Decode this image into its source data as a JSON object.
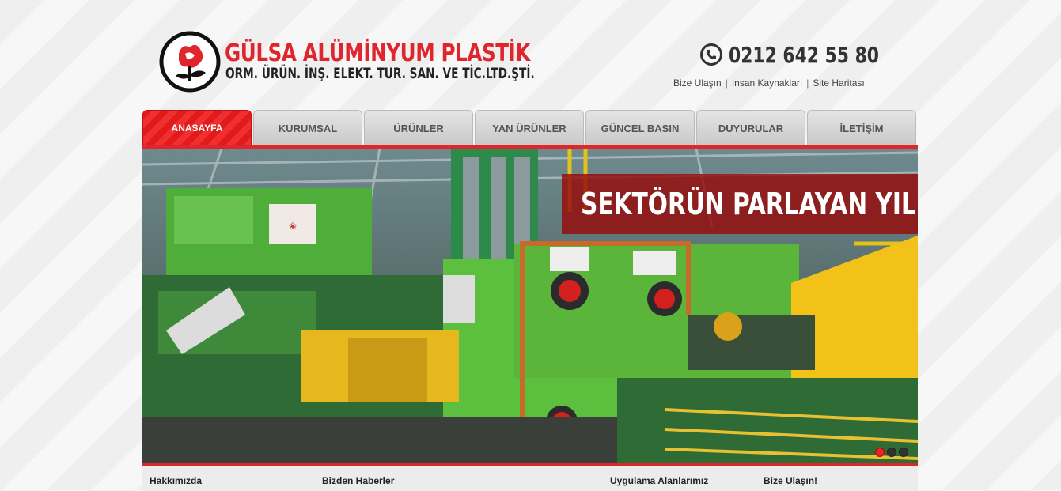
{
  "brand": {
    "title": "GÜLSA ALÜMİNYUM PLASTİK",
    "subtitle": "ORM. ÜRÜN. İNŞ. ELEKT. TUR. SAN. VE TİC.LTD.ŞTİ."
  },
  "contact": {
    "phone": "0212 642 55 80"
  },
  "toplinks": [
    "Bize Ulaşın",
    "İnsan Kaynakları",
    "Site Haritası"
  ],
  "nav": [
    "ANASAYFA",
    "KURUMSAL",
    "ÜRÜNLER",
    "YAN ÜRÜNLER",
    "GÜNCEL BASIN",
    "DUYURULAR",
    "İLETİŞİM"
  ],
  "banner": {
    "caption": "SEKTÖRÜN PARLAYAN YILDIZI...",
    "slides_total": 3,
    "active_slide": 1
  },
  "sections": [
    "Hakkımızda",
    "Bizden Haberler",
    "Uygulama Alanlarımız",
    "Bize Ulaşın!"
  ],
  "colors": {
    "brand_red": "#e0262d",
    "caption_bg": "#960a0a"
  }
}
